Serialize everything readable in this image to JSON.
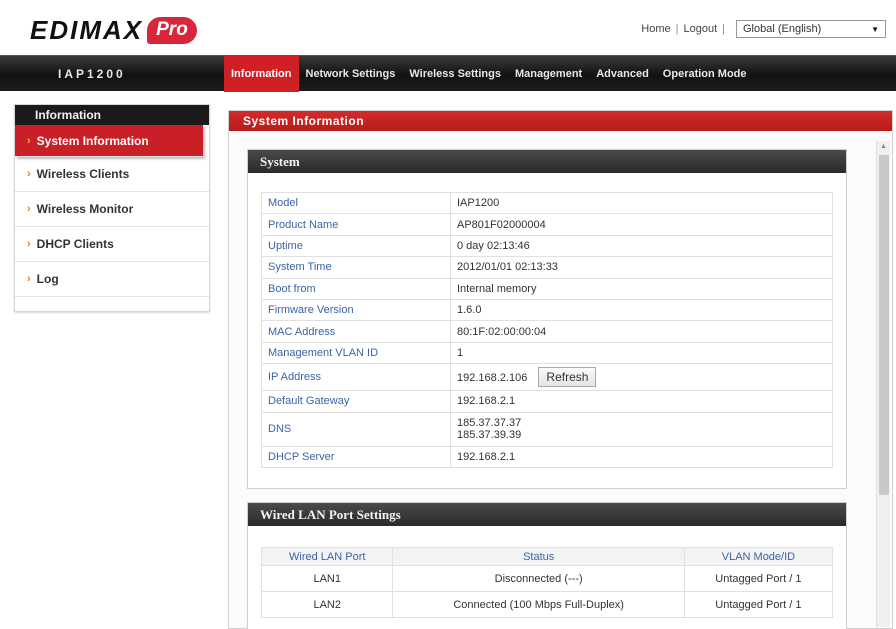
{
  "header": {
    "logo_text": "EDIMAX",
    "logo_badge": "Pro",
    "links": [
      "Home",
      "Logout"
    ],
    "language": "Global (English)"
  },
  "navbar": {
    "device": "IAP1200",
    "items": [
      "Information",
      "Network Settings",
      "Wireless Settings",
      "Management",
      "Advanced",
      "Operation Mode"
    ]
  },
  "sidebar": {
    "title": "Information",
    "items": [
      "System Information",
      "Wireless Clients",
      "Wireless Monitor",
      "DHCP Clients",
      "Log"
    ]
  },
  "main": {
    "title": "System Information",
    "system": {
      "title": "System",
      "rows": [
        {
          "label": "Model",
          "value": "IAP1200"
        },
        {
          "label": "Product Name",
          "value": "AP801F02000004"
        },
        {
          "label": "Uptime",
          "value": "0 day 02:13:46"
        },
        {
          "label": "System Time",
          "value": "2012/01/01 02:13:33"
        },
        {
          "label": "Boot from",
          "value": "Internal memory"
        },
        {
          "label": "Firmware Version",
          "value": "1.6.0"
        },
        {
          "label": "MAC Address",
          "value": "80:1F:02:00:00:04"
        },
        {
          "label": "Management VLAN ID",
          "value": "1"
        },
        {
          "label": "IP Address",
          "value": "192.168.2.106"
        },
        {
          "label": "Default Gateway",
          "value": "192.168.2.1"
        },
        {
          "label": "DNS",
          "value": "185.37.37.37",
          "value2": "185.37.39.39"
        },
        {
          "label": "DHCP Server",
          "value": "192.168.2.1"
        }
      ],
      "refresh_label": "Refresh"
    },
    "wired": {
      "title": "Wired LAN Port Settings",
      "columns": [
        "Wired LAN Port",
        "Status",
        "VLAN Mode/ID"
      ],
      "rows": [
        [
          "LAN1",
          "Disconnected (---)",
          "Untagged Port  /  1"
        ],
        [
          "LAN2",
          "Connected (100 Mbps Full-Duplex)",
          "Untagged Port  /  1"
        ]
      ]
    }
  }
}
